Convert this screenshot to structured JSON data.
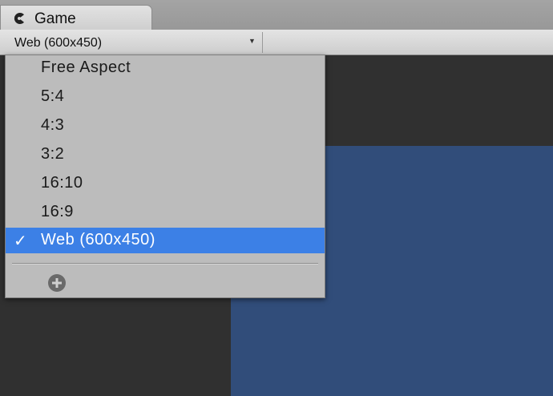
{
  "tab": {
    "label": "Game",
    "icon": "game-controller-icon"
  },
  "toolbar": {
    "aspect_selected": "Web (600x450)"
  },
  "menu": {
    "items": [
      {
        "label": "Free Aspect",
        "selected": false
      },
      {
        "label": "5:4",
        "selected": false
      },
      {
        "label": "4:3",
        "selected": false
      },
      {
        "label": "3:2",
        "selected": false
      },
      {
        "label": "16:10",
        "selected": false
      },
      {
        "label": "16:9",
        "selected": false
      },
      {
        "label": "Web (600x450)",
        "selected": true
      }
    ],
    "check_mark": "✓",
    "add_icon": "plus-circle-icon"
  },
  "colors": {
    "selection": "#3c80e6",
    "viewport": "#314d7a",
    "background": "#303030"
  }
}
